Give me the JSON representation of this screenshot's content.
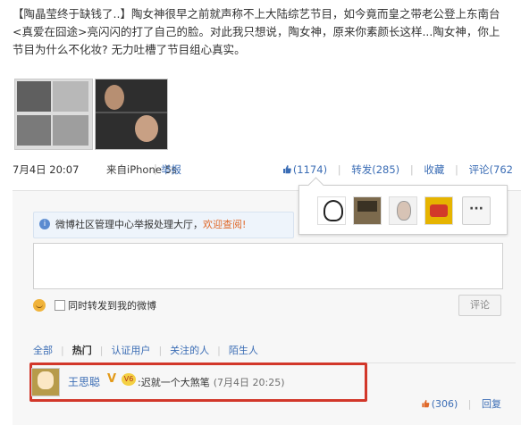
{
  "post": {
    "lead": "【陶晶莹终于缺钱了..】",
    "body": "陶女神很早之前就声称不上大陆综艺节目，如今竟而皇之带老公登上东南台<真爱在囧途>亮闪闪的打了自己的脸。对此我只想说，陶女神，原来你素颜长这样...陶女神，你上节目为什么不化妆? 无力吐槽了节目组心真实。"
  },
  "meta": {
    "time": "7月4日 20:07",
    "device": "来自iPhone 5s",
    "separator": "|",
    "report": "举报",
    "like": "(1174)",
    "repost": "转发(285)",
    "favorite": "收藏",
    "comment": "评论(762"
  },
  "notice": {
    "text": "微博社区管理中心举报处理大厅，",
    "link": "欢迎查阅!",
    "icon": "info-icon"
  },
  "likers": {
    "more": "···"
  },
  "composer": {
    "checkbox_label": "同时转发到我的微博",
    "submit": "评论"
  },
  "filters": {
    "items": [
      "全部",
      "热门",
      "认证用户",
      "关注的人",
      "陌生人"
    ],
    "active": "热门"
  },
  "comment": {
    "name": "王思聪",
    "vip": "V",
    "badge": "V6",
    "text": ":迟就一个大煞笔",
    "time": "(7月4日 20:25)",
    "likes": "(306)",
    "reply": "回复"
  },
  "colors": {
    "link": "#3b6db5",
    "highlight_border": "#d2372a",
    "notice_link": "#e0692a"
  }
}
